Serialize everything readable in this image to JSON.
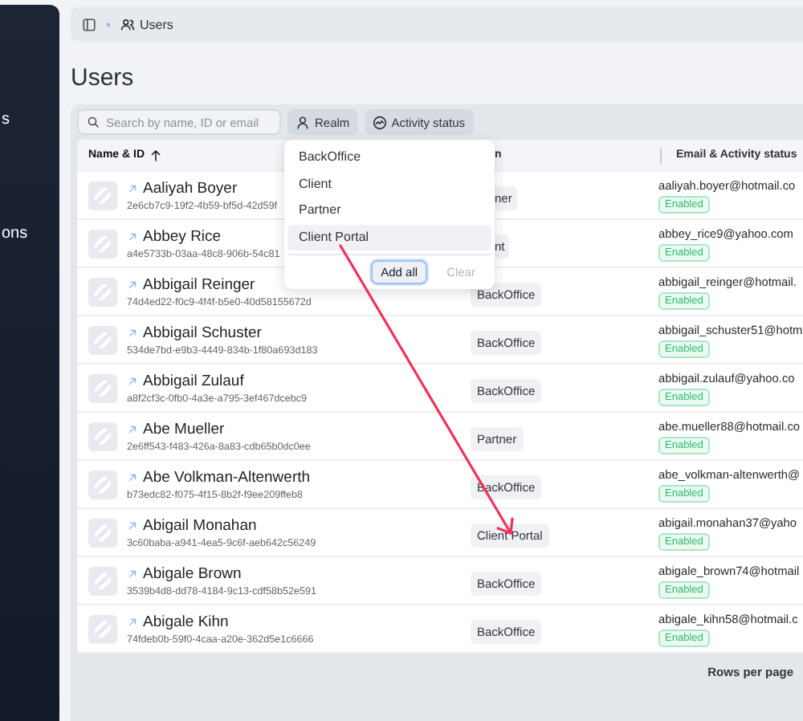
{
  "sidebar": {
    "items": [
      {
        "label": "s"
      },
      {
        "label": "ons"
      }
    ]
  },
  "breadcrumb": {
    "label": "Users"
  },
  "page_title": "Users",
  "toolbar": {
    "search": {
      "placeholder": "Search by name, ID or email"
    },
    "filters": [
      {
        "label": "Realm"
      },
      {
        "label": "Activity status"
      }
    ]
  },
  "table": {
    "columns": [
      {
        "label": "Name & ID",
        "sorted": true,
        "under_menu": false
      },
      {
        "label": "n",
        "sorted": false,
        "under_menu": true
      },
      {
        "label": "Email & Activity status",
        "sorted": false,
        "under_menu": false
      }
    ],
    "rows": [
      {
        "name": "Aaliyah Boyer",
        "id": "2e6cb7c9-19f2-4b59-bf5d-42d59f",
        "realm": "ner",
        "under_menu": true,
        "email": "aaliyah.boyer@hotmail.co",
        "status": "Enabled"
      },
      {
        "name": "Abbey Rice",
        "id": "a4e5733b-03aa-48c8-906b-54c81",
        "realm": "nt",
        "under_menu": true,
        "email": "abbey_rice9@yahoo.com",
        "status": "Enabled"
      },
      {
        "name": "Abbigail Reinger",
        "id": "74d4ed22-f0c9-4f4f-b5e0-40d58155672d",
        "realm": "BackOffice",
        "under_menu": false,
        "email": "abbigail_reinger@hotmail.",
        "status": "Enabled"
      },
      {
        "name": "Abbigail Schuster",
        "id": "534de7bd-e9b3-4449-834b-1f80a693d183",
        "realm": "BackOffice",
        "under_menu": false,
        "email": "abbigail_schuster51@hotm",
        "status": "Enabled"
      },
      {
        "name": "Abbigail Zulauf",
        "id": "a8f2cf3c-0fb0-4a3e-a795-3ef467dcebc9",
        "realm": "BackOffice",
        "under_menu": false,
        "email": "abbigail.zulauf@yahoo.co",
        "status": "Enabled"
      },
      {
        "name": "Abe Mueller",
        "id": "2e6ff543-f483-426a-8a83-cdb65b0dc0ee",
        "realm": "Partner",
        "under_menu": false,
        "email": "abe.mueller88@hotmail.co",
        "status": "Enabled"
      },
      {
        "name": "Abe Volkman-Altenwerth",
        "id": "b73edc82-f075-4f15-8b2f-f9ee209ffeb8",
        "realm": "BackOffice",
        "under_menu": false,
        "email": "abe_volkman-altenwerth@",
        "status": "Enabled"
      },
      {
        "name": "Abigail Monahan",
        "id": "3c60baba-a941-4ea5-9c6f-aeb642c56249",
        "realm": "Client Portal",
        "under_menu": false,
        "email": "abigail.monahan37@yaho",
        "status": "Enabled"
      },
      {
        "name": "Abigale Brown",
        "id": "3539b4d8-dd78-4184-9c13-cdf58b52e591",
        "realm": "BackOffice",
        "under_menu": false,
        "email": "abigale_brown74@hotmail",
        "status": "Enabled"
      },
      {
        "name": "Abigale Kihn",
        "id": "74fdeb0b-59f0-4caa-a20e-362d5e1c6666",
        "realm": "BackOffice",
        "under_menu": false,
        "email": "abigale_kihn58@hotmail.c",
        "status": "Enabled"
      }
    ]
  },
  "realm_menu": {
    "options": [
      {
        "label": "BackOffice",
        "selected": false
      },
      {
        "label": "Client",
        "selected": false
      },
      {
        "label": "Partner",
        "selected": false
      },
      {
        "label": "Client Portal",
        "selected": true
      }
    ],
    "buttons": [
      {
        "label": "Add all",
        "disabled": false
      },
      {
        "label": "Clear",
        "disabled": true
      }
    ]
  },
  "footer": {
    "rows_per_page_label": "Rows per page"
  }
}
